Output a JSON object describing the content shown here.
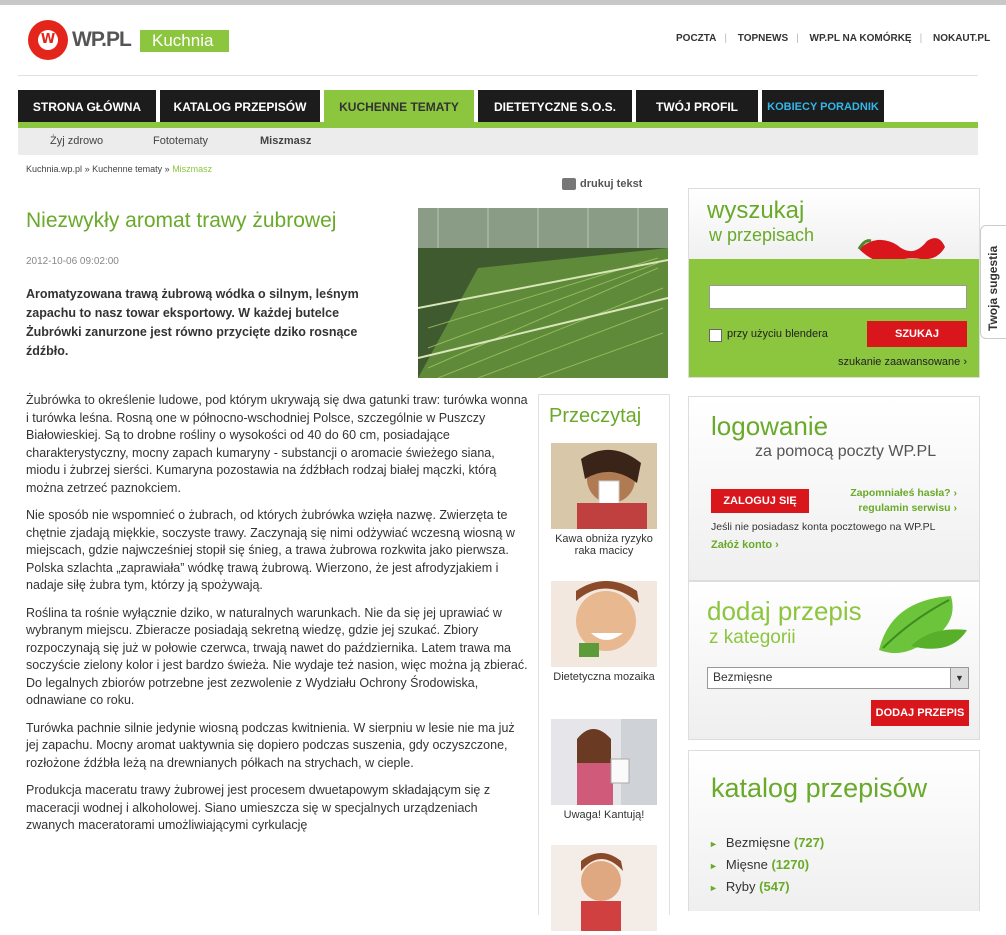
{
  "header": {
    "logo_text": "WP.PL",
    "logo_letter": "W",
    "section": "Kuchnia",
    "toplinks": [
      "POCZTA",
      "TOPNEWS",
      "WP.PL NA KOMÓRKĘ",
      "NOKAUT.PL"
    ]
  },
  "nav": {
    "tabs": [
      "STRONA GŁÓWNA",
      "KATALOG PRZEPISÓW",
      "KUCHENNE TEMATY",
      "DIETETYCZNE S.O.S.",
      "TWÓJ PROFIL",
      "KOBIECY PORADNIK"
    ],
    "active": "KUCHENNE TEMATY",
    "subtabs": [
      "Żyj zdrowo",
      "Fototematy",
      "Miszmasz"
    ]
  },
  "breadcrumb": {
    "items": [
      "Kuchnia.wp.pl",
      "Kuchenne tematy",
      "Miszmasz"
    ],
    "sep": "»"
  },
  "article": {
    "print_label": "drukuj tekst",
    "title": "Niezwykły aromat trawy żubrowej",
    "date": "2012-10-06 09:02:00",
    "lead": "Aromatyzowana trawą żubrową wódka o silnym, leśnym zapachu to nasz towar eksportowy. W każdej butelce Żubrówki zanurzone jest równo przycięte dziko rosnące źdźbło.",
    "paragraphs": [
      "Żubrówka to określenie ludowe, pod którym ukrywają się dwa gatunki traw: turówka wonna i turówka leśna. Rosną one w północno-wschodniej Polsce, szczególnie w Puszczy Białowieskiej. Są to drobne rośliny o wysokości od 40 do 60 cm, posiadające charakterystyczny, mocny zapach kumaryny - substancji o aromacie świeżego siana, miodu i żubrzej sierści. Kumaryna pozostawia na źdźbłach rodzaj białej mączki, którą można zetrzeć paznokciem.",
      "Nie sposób nie wspomnieć o żubrach, od których żubrówka wzięła nazwę. Zwierzęta te chętnie zjadają miękkie, soczyste trawy. Zaczynają się nimi odżywiać wczesną wiosną w miejscach, gdzie najwcześniej stopił się śnieg, a trawa żubrowa rozkwita jako pierwsza. Polska szlachta „zaprawiała” wódkę trawą żubrową. Wierzono, że jest afrodyzjakiem i nadaje siłę żubra tym, którzy ją spożywają.",
      "Roślina ta rośnie wyłącznie dziko, w naturalnych warunkach. Nie da się jej uprawiać w wybranym miejscu. Zbieracze posiadają sekretną wiedzę, gdzie jej szukać. Zbiory rozpoczynają się już w połowie czerwca, trwają nawet do października. Latem trawa ma soczyście zielony kolor i jest bardzo świeża. Nie wydaje też nasion, więc można ją zbierać. Do legalnych zbiorów potrzebne jest zezwolenie z Wydziału Ochrony Środowiska, odnawiane co roku.",
      "Turówka pachnie silnie jedynie wiosną podczas kwitnienia. W sierpniu w lesie nie ma już jej zapachu. Mocny aromat uaktywnia się dopiero podczas suszenia, gdy oczyszczone, rozłożone źdźbła leżą na drewnianych półkach na strychach, w cieple.",
      "Produkcja maceratu trawy żubrowej jest procesem dwuetapowym składającym się z maceracji wodnej i alkoholowej. Siano umieszcza się w specjalnych urządzeniach zwanych maceratorami umożliwiającymi cyrkulację"
    ]
  },
  "przeczytaj": {
    "title": "Przeczytaj",
    "items": [
      "Kawa obniża ryzyko raka macicy",
      "Dietetyczna mozaika",
      "Uwaga! Kantują!",
      ""
    ]
  },
  "search_box": {
    "title1": "wyszukaj",
    "title2": "w przepisach",
    "input_value": "",
    "checkbox_label": "przy użyciu blendera",
    "button": "SZUKAJ",
    "advanced": "szukanie zaawansowane ›"
  },
  "login_box": {
    "title1": "logowanie",
    "title2": "za pomocą poczty WP.PL",
    "button": "ZALOGUJ SIĘ",
    "forgot": "Zapomniałeś hasła? ›",
    "terms": "regulamin serwisu ›",
    "note": "Jeśli nie posiadasz konta pocztowego na WP.PL",
    "create": "Załóż konto ›"
  },
  "add_recipe": {
    "title1": "dodaj przepis",
    "title2": "z kategorii",
    "selected": "Bezmięsne",
    "button": "DODAJ PRZEPIS"
  },
  "catalog": {
    "title": "katalog przepisów",
    "items": [
      {
        "name": "Bezmięsne",
        "count": "(727)"
      },
      {
        "name": "Mięsne",
        "count": "(1270)"
      },
      {
        "name": "Ryby",
        "count": "(547)"
      }
    ]
  },
  "suggest": "Twoja sugestia",
  "colors": {
    "green": "#8cc63f",
    "red": "#d9161c",
    "dark": "#1c1c1c"
  }
}
